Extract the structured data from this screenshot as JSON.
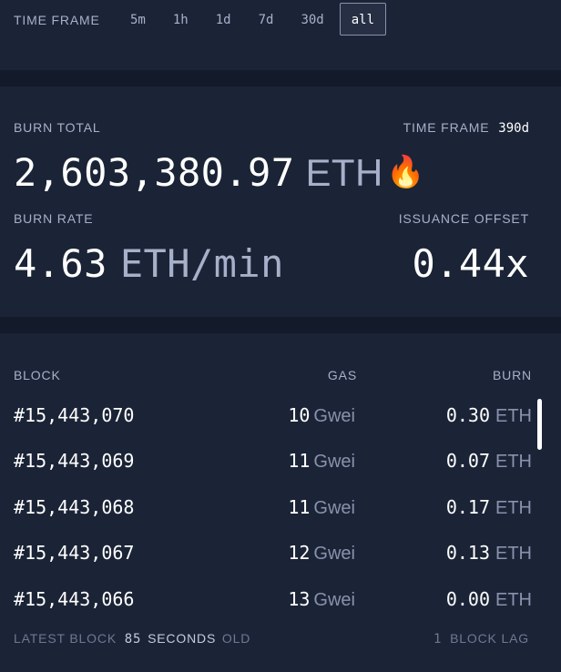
{
  "timeframe": {
    "label": "TIME FRAME",
    "options": [
      "5m",
      "1h",
      "1d",
      "7d",
      "30d",
      "all"
    ],
    "selected": "all"
  },
  "burn_total": {
    "label": "BURN TOTAL",
    "value": "2,603,380.97",
    "unit": "ETH",
    "flame_icon": "fire-emoji",
    "timeframe_label": "TIME FRAME",
    "timeframe_value": "390d"
  },
  "burn_rate": {
    "label": "BURN RATE",
    "value": "4.63",
    "unit": "ETH/min"
  },
  "issuance_offset": {
    "label": "ISSUANCE OFFSET",
    "value": "0.44x"
  },
  "table": {
    "headers": {
      "block": "BLOCK",
      "gas": "GAS",
      "burn": "BURN"
    },
    "rows": [
      {
        "block": "#15,443,070",
        "gas": "10",
        "gas_unit": "Gwei",
        "burn": "0.30",
        "burn_unit": "ETH"
      },
      {
        "block": "#15,443,069",
        "gas": "11",
        "gas_unit": "Gwei",
        "burn": "0.07",
        "burn_unit": "ETH"
      },
      {
        "block": "#15,443,068",
        "gas": "11",
        "gas_unit": "Gwei",
        "burn": "0.17",
        "burn_unit": "ETH"
      },
      {
        "block": "#15,443,067",
        "gas": "12",
        "gas_unit": "Gwei",
        "burn": "0.13",
        "burn_unit": "ETH"
      },
      {
        "block": "#15,443,066",
        "gas": "13",
        "gas_unit": "Gwei",
        "burn": "0.00",
        "burn_unit": "ETH"
      }
    ]
  },
  "footer": {
    "latest_block_prefix": "LATEST BLOCK",
    "seconds": "85",
    "seconds_label": "SECONDS",
    "old": "OLD",
    "lag_count": "1",
    "lag_label": "BLOCK LAG"
  },
  "colors": {
    "background": "#131a2a",
    "card": "#1b2436",
    "muted": "#8991ad",
    "text": "#ffffff"
  }
}
